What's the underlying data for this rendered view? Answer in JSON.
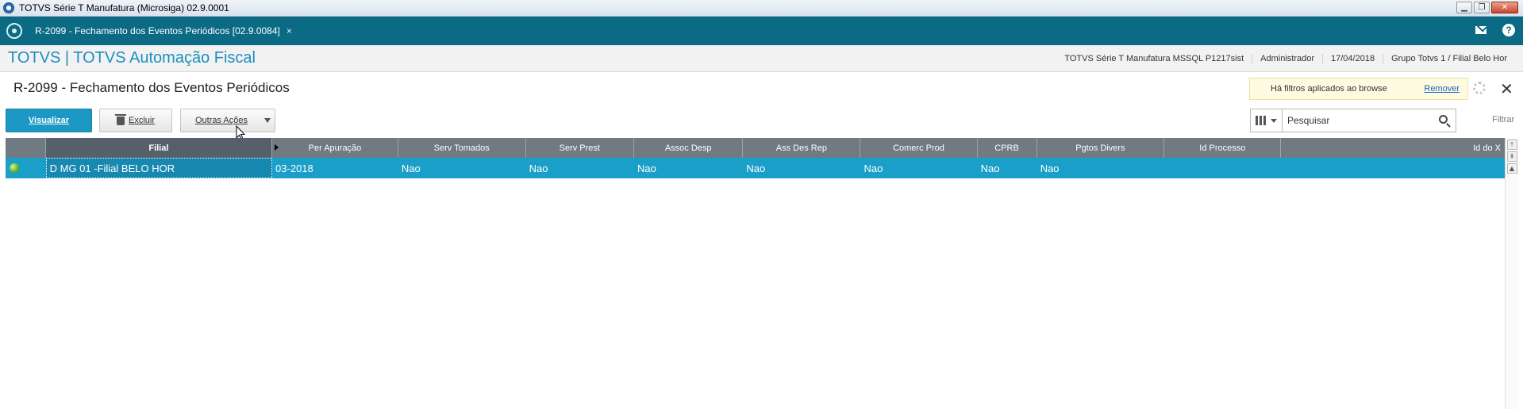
{
  "window": {
    "title": "TOTVS Série T Manufatura (Microsiga) 02.9.0001",
    "controls": [
      "minimize",
      "maximize",
      "close"
    ]
  },
  "tabbar": {
    "tab_label": "R-2099 - Fechamento dos Eventos Periódicos [02.9.0084]",
    "tab_close": "×"
  },
  "header": {
    "brand": "TOTVS | TOTVS Automação Fiscal",
    "environment": "TOTVS Série T Manufatura MSSQL P1217sist",
    "user": "Administrador",
    "date": "17/04/2018",
    "branch": "Grupo Totvs 1 / Filial Belo Hor"
  },
  "page": {
    "title": "R-2099 - Fechamento dos Eventos Periódicos"
  },
  "filter_notice": {
    "message": "Há filtros aplicados ao browse",
    "remove_label": "Remover"
  },
  "toolbar": {
    "visualizar": "Visualizar",
    "excluir": "Excluir",
    "outras_acoes": "Outras Ações"
  },
  "search": {
    "placeholder": "Pesquisar",
    "value": "Pesquisar",
    "filtrar_label": "Filtrar"
  },
  "grid": {
    "columns": [
      "Filial",
      "Per Apuração",
      "Serv Tomados",
      "Serv Prest",
      "Assoc Desp",
      "Ass Des Rep",
      "Comerc Prod",
      "CPRB",
      "Pgtos Divers",
      "Id Processo",
      "Id do X"
    ],
    "rows": [
      {
        "status": "green",
        "filial": "D MG 01 -Filial BELO HOR",
        "per_apuracao": "03-2018",
        "serv_tomados": "Nao",
        "serv_prest": "Nao",
        "assoc_desp": "Nao",
        "ass_des_rep": "Nao",
        "comerc_prod": "Nao",
        "cprb": "Nao",
        "pgtos_divers": "Nao",
        "id_processo": "",
        "id_do_x": ""
      }
    ]
  },
  "colors": {
    "tabbar": "#0b6a84",
    "brand": "#1d8fbf",
    "primary_button": "#1b98c4",
    "grid_header": "#6f7a82",
    "selected_row": "#1a9fc8"
  }
}
